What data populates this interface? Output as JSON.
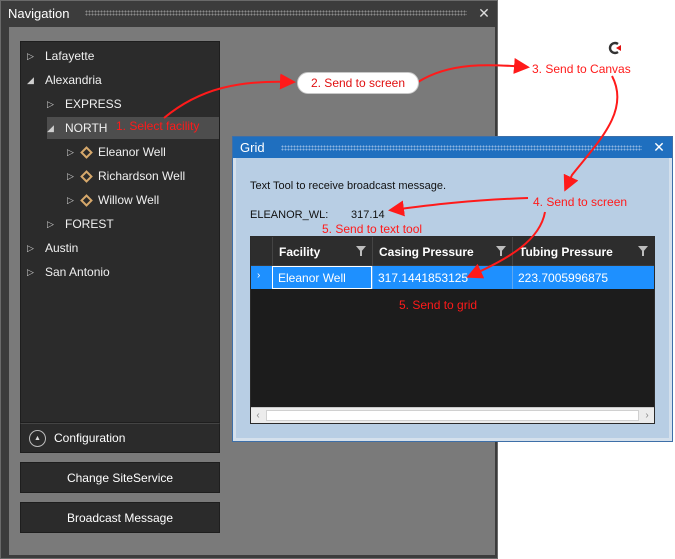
{
  "nav_window": {
    "title": "Navigation",
    "tree": [
      {
        "label": "Lafayette",
        "level": 0,
        "expanded": false
      },
      {
        "label": "Alexandria",
        "level": 0,
        "expanded": true
      },
      {
        "label": "EXPRESS",
        "level": 1,
        "expanded": false
      },
      {
        "label": "NORTH",
        "level": 1,
        "expanded": true,
        "selected": true
      },
      {
        "label": "Eleanor Well",
        "level": 2,
        "expanded": false,
        "icon": "facility-diamond-icon"
      },
      {
        "label": "Richardson Well",
        "level": 2,
        "expanded": false,
        "icon": "facility-diamond-icon"
      },
      {
        "label": "Willow Well",
        "level": 2,
        "expanded": false,
        "icon": "facility-diamond-icon"
      },
      {
        "label": "FOREST",
        "level": 1,
        "expanded": false
      },
      {
        "label": "Austin",
        "level": 0,
        "expanded": false
      },
      {
        "label": "San Antonio",
        "level": 0,
        "expanded": false
      }
    ],
    "config_label": "Configuration",
    "buttons": {
      "change_site_service": "Change SiteService",
      "broadcast_message": "Broadcast Message"
    }
  },
  "grid_window": {
    "title": "Grid",
    "text_tool_message": "Text Tool to receive broadcast message.",
    "tool_label": "ELEANOR_WL:",
    "tool_value": "317.14",
    "columns": [
      "Facility",
      "Casing Pressure",
      "Tubing Pressure"
    ],
    "rows": [
      {
        "facility": "Eleanor Well",
        "casing_pressure": "317.1441853125",
        "tubing_pressure": "223.7005996875"
      }
    ]
  },
  "annotations": {
    "step1": "1. Select facility",
    "step2": "2. Send to screen",
    "step3": "3. Send to Canvas",
    "step4": "4. Send to screen",
    "step5_text_tool": "5. Send to text tool",
    "step5_grid": "5. Send to grid"
  },
  "colors": {
    "annotation": "#ff1a1a",
    "grid_title_bar": "#1f6fbf",
    "selected_row": "#1e90ff",
    "facility_icon": "#d6a86b"
  }
}
